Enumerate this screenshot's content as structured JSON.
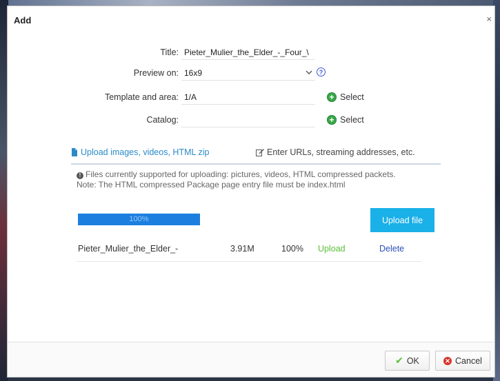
{
  "dialog": {
    "title": "Add",
    "close_icon": "close-icon",
    "close_glyph": "×"
  },
  "form": {
    "title_label": "Title:",
    "title_value": "Pieter_Mulier_the_Elder_-_Four_\\",
    "preview_label": "Preview on:",
    "preview_value": "16x9",
    "preview_help_glyph": "?",
    "template_label": "Template and area:",
    "template_value": "1/A",
    "template_select_label": "Select",
    "catalog_label": "Catalog:",
    "catalog_value": "",
    "catalog_select_label": "Select",
    "select_plus_glyph": "+"
  },
  "tabs": [
    {
      "label": "Upload images, videos, HTML zip",
      "icon": "file-icon",
      "active": true
    },
    {
      "label": "Enter URLs, streaming addresses, etc.",
      "icon": "edit-icon",
      "active": false
    }
  ],
  "info": {
    "icon_glyph": "!",
    "line1": "Files currently supported for uploading: pictures, videos, HTML compressed packets.",
    "line2": "Note: The HTML compressed Package page entry file must be index.html"
  },
  "upload": {
    "progress_percent": 100,
    "progress_label": "100%",
    "button_label": "Upload file"
  },
  "files": [
    {
      "name": "Pieter_Mulier_the_Elder_-",
      "size": "3.91M",
      "percent": "100%",
      "status": "Upload",
      "action": "Delete"
    }
  ],
  "footer": {
    "ok_label": "OK",
    "cancel_label": "Cancel",
    "ok_glyph": "✔",
    "cancel_glyph": "✕"
  },
  "colors": {
    "accent": "#1ab0e8",
    "progress": "#1c7fe0",
    "tab_active": "#2a8ac8",
    "status_green": "#5bbf3a",
    "delete_link": "#2a4fb8"
  }
}
